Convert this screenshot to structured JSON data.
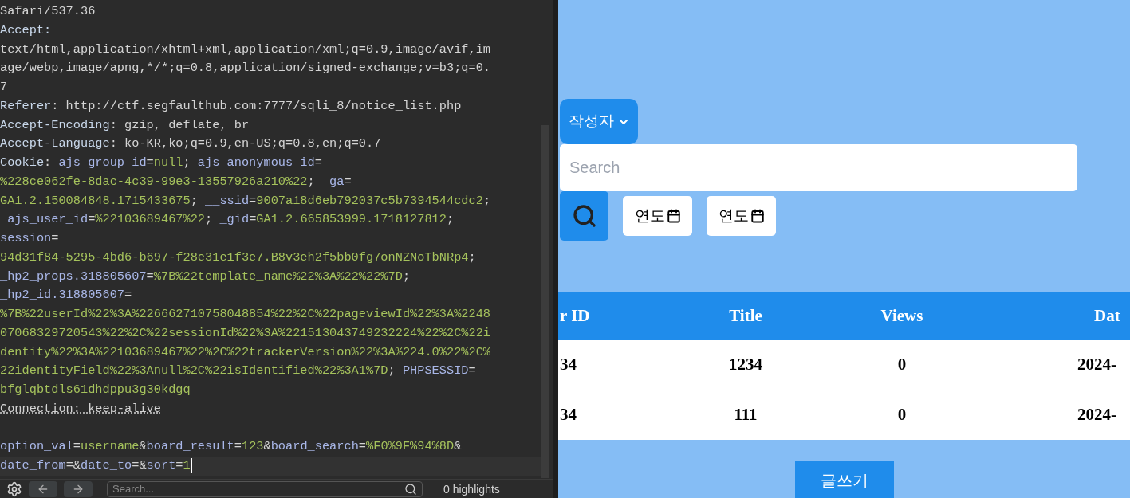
{
  "editor": {
    "lines": [
      [
        {
          "text": "Safari/537.36",
          "kind": "plain"
        }
      ],
      [
        {
          "text": "Accept:",
          "kind": "key"
        }
      ],
      [
        {
          "text": "text/html,application/xhtml+xml,application/xml;q=0.9,image/avif,im",
          "kind": "plain"
        }
      ],
      [
        {
          "text": "age/webp,image/apng,*/*;q=0.8,application/signed-exchange;v=b3;q=0.",
          "kind": "plain"
        }
      ],
      [
        {
          "text": "7",
          "kind": "plain"
        }
      ],
      [
        {
          "text": "Referer",
          "kind": "key"
        },
        {
          "text": ": http://ctf.segfaulthub.com:7777/sqli_8/notice_list.php",
          "kind": "plain"
        }
      ],
      [
        {
          "text": "Accept-Encoding",
          "kind": "key"
        },
        {
          "text": ": gzip, deflate, br",
          "kind": "plain"
        }
      ],
      [
        {
          "text": "Accept-Language",
          "kind": "key"
        },
        {
          "text": ": ko-KR,ko;q=0.9,en-US;q=0.8,en;q=0.7",
          "kind": "plain"
        }
      ],
      [
        {
          "text": "Cookie",
          "kind": "key"
        },
        {
          "text": ": ",
          "kind": "plain"
        },
        {
          "text": "ajs_group_id",
          "kind": "name"
        },
        {
          "text": "=",
          "kind": "plain"
        },
        {
          "text": "null",
          "kind": "value"
        },
        {
          "text": "; ",
          "kind": "plain"
        },
        {
          "text": "ajs_anonymous_id",
          "kind": "name"
        },
        {
          "text": "=",
          "kind": "plain"
        }
      ],
      [
        {
          "text": "%228ce062fe-8dac-4c39-99e3-13557926a210%22",
          "kind": "value"
        },
        {
          "text": "; ",
          "kind": "plain"
        },
        {
          "text": "_ga",
          "kind": "name"
        },
        {
          "text": "=",
          "kind": "plain"
        }
      ],
      [
        {
          "text": "GA1.2.150084848.1715433675",
          "kind": "value"
        },
        {
          "text": "; ",
          "kind": "plain"
        },
        {
          "text": "__ssid",
          "kind": "name"
        },
        {
          "text": "=",
          "kind": "plain"
        },
        {
          "text": "9007a18d6eb792037c5b7394544cdc2",
          "kind": "value"
        },
        {
          "text": ";",
          "kind": "plain"
        }
      ],
      [
        {
          "text": " ajs_user_id",
          "kind": "name"
        },
        {
          "text": "=",
          "kind": "plain"
        },
        {
          "text": "%22103689467%22",
          "kind": "value"
        },
        {
          "text": "; ",
          "kind": "plain"
        },
        {
          "text": "_gid",
          "kind": "name"
        },
        {
          "text": "=",
          "kind": "plain"
        },
        {
          "text": "GA1.2.665853999.1718127812",
          "kind": "value"
        },
        {
          "text": ";",
          "kind": "plain"
        }
      ],
      [
        {
          "text": "session",
          "kind": "name"
        },
        {
          "text": "=",
          "kind": "plain"
        }
      ],
      [
        {
          "text": "94d31f84-5295-4bd6-b697-f28e31e1f3e7.B8v3eh2f5bb0fg7onNZNoTbNRp4",
          "kind": "value"
        },
        {
          "text": ";",
          "kind": "plain"
        }
      ],
      [
        {
          "text": "_hp2_props.318805607",
          "kind": "name"
        },
        {
          "text": "=",
          "kind": "plain"
        },
        {
          "text": "%7B%22template_name%22%3A%22%22%7D",
          "kind": "value"
        },
        {
          "text": ";",
          "kind": "plain"
        }
      ],
      [
        {
          "text": "_hp2_id.318805607",
          "kind": "name"
        },
        {
          "text": "=",
          "kind": "plain"
        }
      ],
      [
        {
          "text": "%7B%22userId%22%3A%226662710758048854%22%2C%22pageviewId%22%3A%2248",
          "kind": "value"
        }
      ],
      [
        {
          "text": "07068329720543%22%2C%22sessionId%22%3A%221513043749232224%22%2C%22i",
          "kind": "value"
        }
      ],
      [
        {
          "text": "dentity%22%3A%22103689467%22%2C%22trackerVersion%22%3A%224.0%22%2C%",
          "kind": "value"
        }
      ],
      [
        {
          "text": "22identityField%22%3Anull%2C%22isIdentified%22%3A1%7D",
          "kind": "value"
        },
        {
          "text": "; ",
          "kind": "plain"
        },
        {
          "text": "PHPSESSID",
          "kind": "name"
        },
        {
          "text": "=",
          "kind": "plain"
        }
      ],
      [
        {
          "text": "bfglqbtdls61dhdppu3g30kdgq",
          "kind": "value"
        }
      ],
      [
        {
          "text": "Connection: keep-alive",
          "kind": "dotted"
        }
      ]
    ],
    "body_lines": [
      [
        {
          "text": "option_val",
          "kind": "name"
        },
        {
          "text": "=",
          "kind": "plain"
        },
        {
          "text": "username",
          "kind": "value"
        },
        {
          "text": "&",
          "kind": "plain"
        },
        {
          "text": "board_result",
          "kind": "name"
        },
        {
          "text": "=",
          "kind": "plain"
        },
        {
          "text": "123",
          "kind": "value"
        },
        {
          "text": "&",
          "kind": "plain"
        },
        {
          "text": "board_search",
          "kind": "name"
        },
        {
          "text": "=",
          "kind": "plain"
        },
        {
          "text": "%F0%9F%94%8D",
          "kind": "value"
        },
        {
          "text": "&",
          "kind": "plain"
        }
      ],
      [
        {
          "text": "date_from",
          "kind": "name"
        },
        {
          "text": "=&",
          "kind": "plain"
        },
        {
          "text": "date_to",
          "kind": "name"
        },
        {
          "text": "=&",
          "kind": "plain"
        },
        {
          "text": "sort",
          "kind": "name"
        },
        {
          "text": "=",
          "kind": "plain"
        },
        {
          "text": "1",
          "kind": "value"
        }
      ]
    ],
    "search": {
      "placeholder": "Search..."
    },
    "highlights": "0 highlights"
  },
  "board": {
    "filter": {
      "label": "작성자"
    },
    "search": {
      "placeholder": "Search"
    },
    "dates": [
      {
        "label": "연도"
      },
      {
        "label": "연도"
      }
    ],
    "table": {
      "columns": [
        "r ID",
        "Title",
        "Views",
        "Dat"
      ],
      "rows": [
        [
          "34",
          "1234",
          "0",
          "2024-"
        ],
        [
          "34",
          "111",
          "0",
          "2024-"
        ]
      ]
    },
    "write_button": "글쓰기"
  }
}
